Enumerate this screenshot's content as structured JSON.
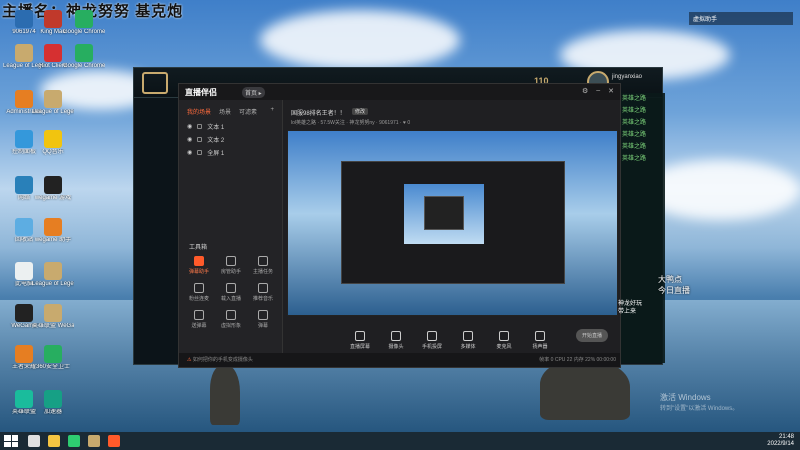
{
  "overlay": {
    "title": "主播名：神龙努努  基克炮"
  },
  "desktop_icons": [
    {
      "label": "9061974",
      "color": "#2b6cb0"
    },
    {
      "label": "King Mau",
      "color": "#c0392b"
    },
    {
      "label": "Google Chrome",
      "color": "#27ae60"
    },
    {
      "label": "League of Legends",
      "color": "#c8aa6e"
    },
    {
      "label": "Riot Client",
      "color": "#d63031"
    },
    {
      "label": "Google Chrome",
      "color": "#27ae60"
    },
    {
      "label": "Administrator",
      "color": "#e67e22"
    },
    {
      "label": "League of Legends",
      "color": "#c8aa6e"
    },
    {
      "label": "控制面板",
      "color": "#3498db"
    },
    {
      "label": "QQ音乐",
      "color": "#f1c40f"
    },
    {
      "label": "网络",
      "color": "#2980b9"
    },
    {
      "label": "wegame 游戏",
      "color": "#222222"
    },
    {
      "label": "回收站",
      "color": "#5dade2"
    },
    {
      "label": "wegame 助手",
      "color": "#e67e22"
    },
    {
      "label": "此电脑",
      "color": "#ecf0f1"
    },
    {
      "label": "League of Legends",
      "color": "#c8aa6e"
    },
    {
      "label": "WeGame",
      "color": "#222222"
    },
    {
      "label": "英雄联盟 WeGame版",
      "color": "#c8aa6e"
    },
    {
      "label": "王者荣耀",
      "color": "#e67e22"
    },
    {
      "label": "360安全卫士",
      "color": "#27ae60"
    },
    {
      "label": "英雄联盟",
      "color": "#1abc9c"
    },
    {
      "label": "加速器",
      "color": "#16a085"
    }
  ],
  "game": {
    "gold": "110",
    "username": "jingyanxiao"
  },
  "streamer": {
    "app_name": "直播伴侣",
    "badge": "首页 ▸",
    "tabs": [
      "我的场景",
      "场景",
      "可滤素"
    ],
    "scenes": [
      "文本 1",
      "文本 2",
      "全屏 1"
    ],
    "tools_title": "工具箱",
    "tools": [
      {
        "label": "弹幕助手",
        "hot": true
      },
      {
        "label": "房管助手",
        "hot": false
      },
      {
        "label": "主播任务",
        "hot": false
      },
      {
        "label": "粉丝连麦",
        "hot": false
      },
      {
        "label": "载入直播",
        "hot": false
      },
      {
        "label": "推荐音乐",
        "hot": false
      },
      {
        "label": "送弹幕",
        "hot": false
      },
      {
        "label": "虚拟形象",
        "hot": false
      },
      {
        "label": "弹幕",
        "hot": false
      }
    ],
    "stream_title": "国服98排名王者！！",
    "stream_btn": "修改",
    "stream_sub": "lol英雄之路 · 57.5W关注 · 神龙努努ny · 9061971 · ♥ 0",
    "bottom_buttons": [
      "直播屏幕",
      "摄像头",
      "手机投屏",
      "多媒体",
      "麦克风",
      "扬声器"
    ],
    "go_live": "开始直播",
    "status_warn": "如何把你的手机变成摄像头",
    "status_right": "帧率 0  CPU 22  内存 22%  00:00:00"
  },
  "chat_left": [
    "英雄之路",
    "英雄之路",
    "英雄之路",
    "英雄之路",
    "英雄之路",
    "英雄之路"
  ],
  "right_overlay": {
    "window_title": "虚拟助手",
    "live_text_1": "大鸭点",
    "live_text_2": "今日直播",
    "chat_1": "神龙好玩",
    "chat_2": "带上来"
  },
  "watermark": {
    "line1": "激活 Windows",
    "line2": "转到\"设置\"以激活 Windows。"
  },
  "taskbar": {
    "time": "21:48",
    "date": "2022/9/14"
  }
}
